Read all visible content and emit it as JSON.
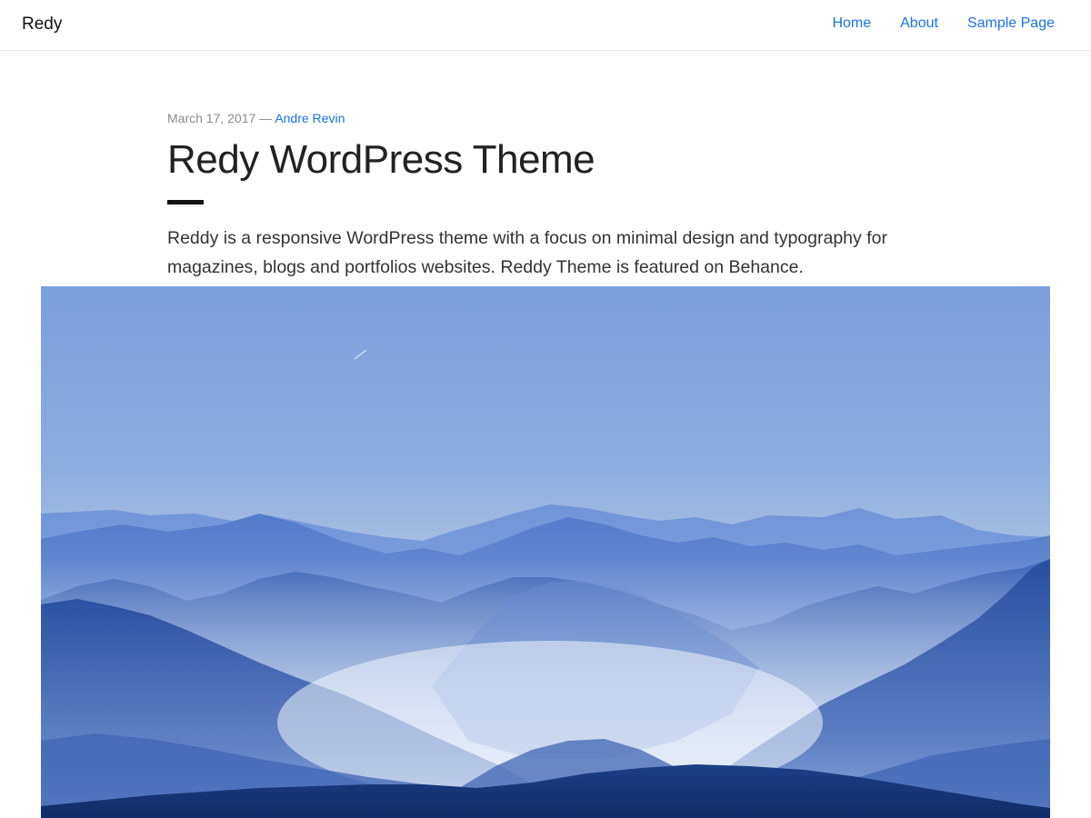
{
  "site": {
    "title": "Redy"
  },
  "nav": {
    "items": [
      "Home",
      "About",
      "Sample Page"
    ]
  },
  "post": {
    "date": "March 17, 2017",
    "separator": " — ",
    "author": "Andre Revin",
    "title": "Redy WordPress Theme",
    "excerpt": "Reddy is a responsive WordPress theme with a focus on minimal design and typography for magazines, blogs and portfolios websites. Reddy Theme is featured on Behance."
  },
  "featured_image": {
    "subject": "misty blue mountain ranges under a pale blue sky"
  },
  "colors": {
    "link": "#1a73e8",
    "text": "#222222",
    "muted": "#8c8c8c"
  }
}
